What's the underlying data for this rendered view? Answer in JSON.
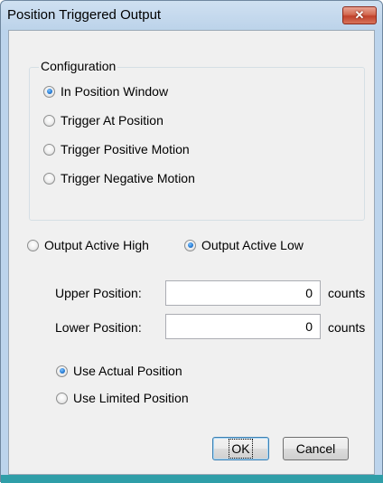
{
  "window": {
    "title": "Position Triggered Output",
    "close_label": "✕"
  },
  "configuration": {
    "label": "Configuration",
    "options": [
      {
        "label": "In Position Window",
        "checked": true
      },
      {
        "label": "Trigger At Position",
        "checked": false
      },
      {
        "label": "Trigger Positive Motion",
        "checked": false
      },
      {
        "label": "Trigger Negative Motion",
        "checked": false
      }
    ]
  },
  "output_polarity": {
    "options": [
      {
        "label": "Output Active High",
        "checked": false
      },
      {
        "label": "Output Active Low",
        "checked": true
      }
    ]
  },
  "positions": {
    "upper": {
      "label": "Upper Position:",
      "value": "0",
      "unit": "counts"
    },
    "lower": {
      "label": "Lower Position:",
      "value": "0",
      "unit": "counts"
    }
  },
  "position_source": {
    "options": [
      {
        "label": "Use Actual Position",
        "checked": true
      },
      {
        "label": "Use Limited Position",
        "checked": false
      }
    ]
  },
  "buttons": {
    "ok": "OK",
    "cancel": "Cancel"
  }
}
